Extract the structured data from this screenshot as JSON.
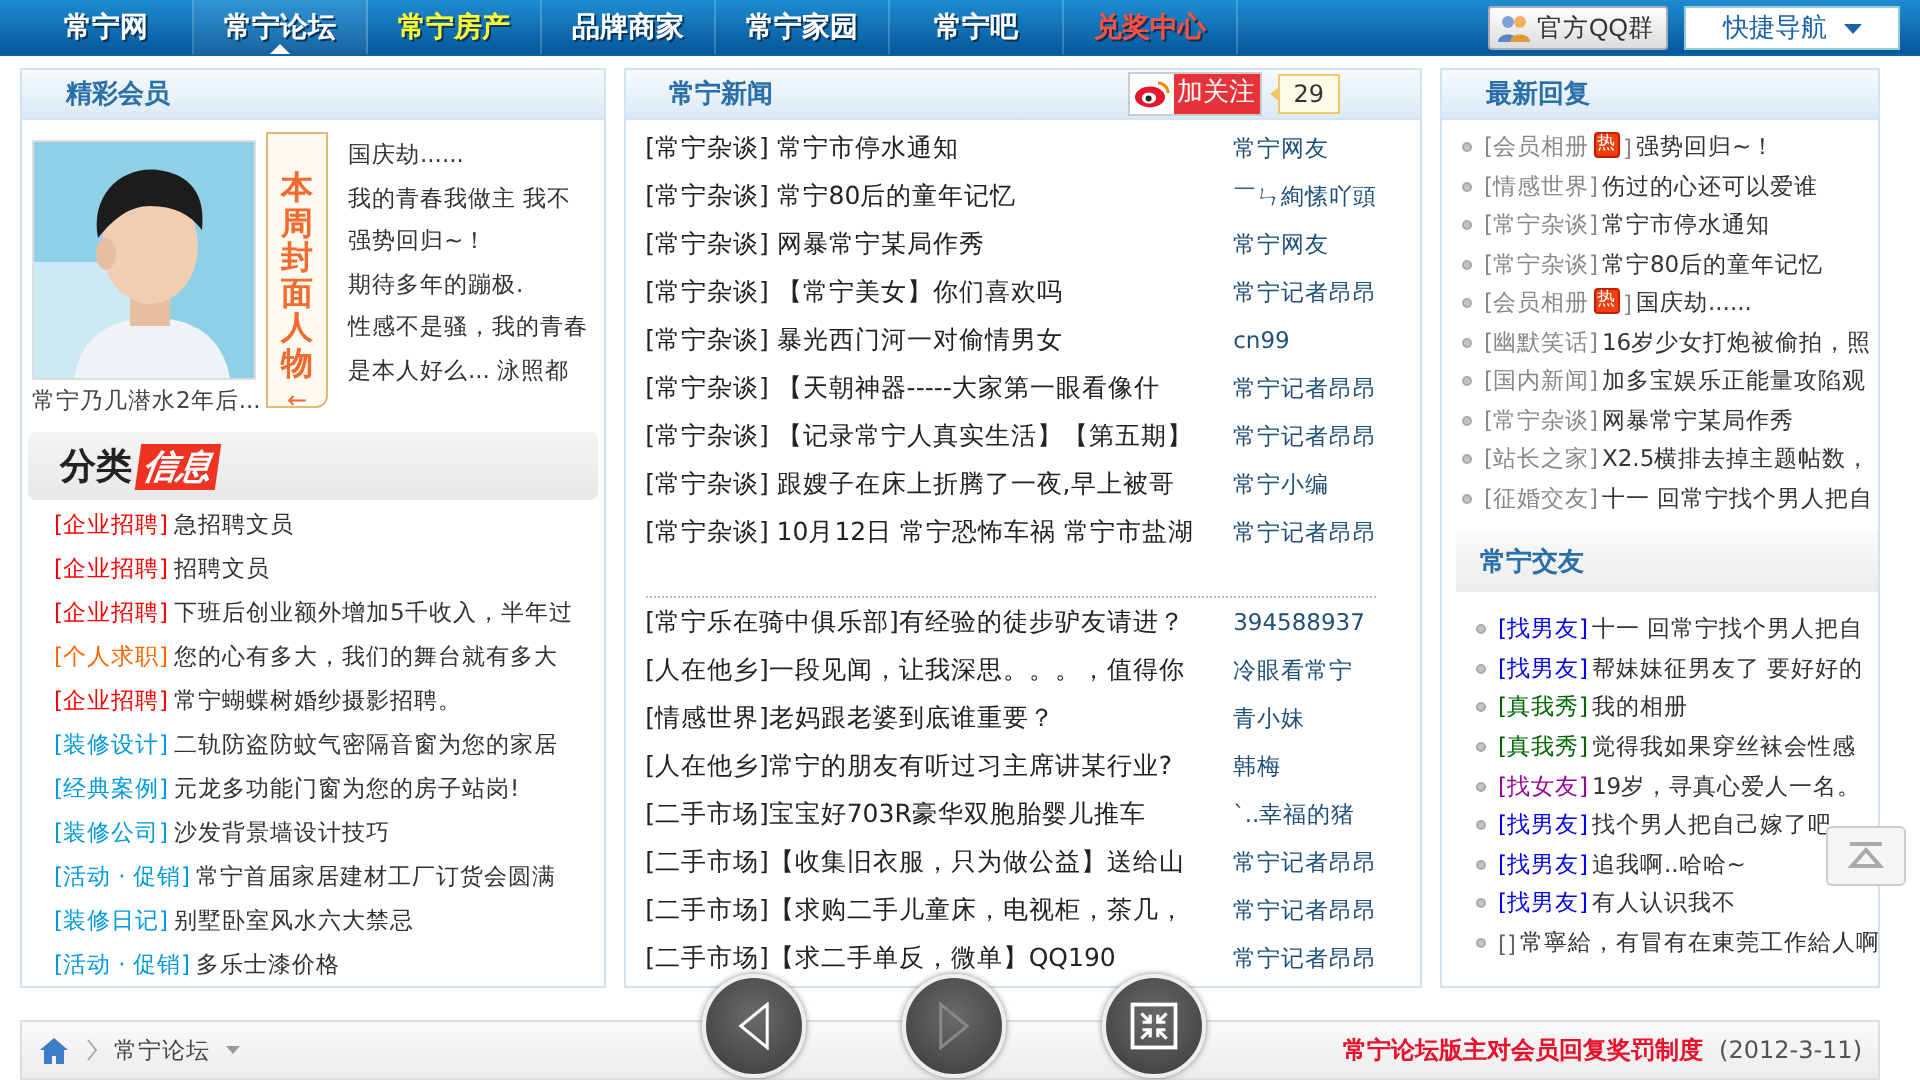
{
  "nav": {
    "items": [
      {
        "label": "常宁网",
        "selected": false,
        "color": "#ffffff"
      },
      {
        "label": "常宁论坛",
        "selected": true,
        "color": "#ffffff"
      },
      {
        "label": "常宁房产",
        "selected": false,
        "color": "#ffff33"
      },
      {
        "label": "品牌商家",
        "selected": false,
        "color": "#ffffff"
      },
      {
        "label": "常宁家园",
        "selected": false,
        "color": "#ffffff"
      },
      {
        "label": "常宁吧",
        "selected": false,
        "color": "#ffffff"
      },
      {
        "label": "兑奖中心",
        "selected": false,
        "color": "#ff5040"
      }
    ],
    "qq_button": "官方QQ群",
    "quick_nav": "快捷导航"
  },
  "members": {
    "title": "精彩会员",
    "photo": {
      "kind": "picture",
      "caption": "常宁乃几潜水2年后..."
    },
    "cover_tag": "本周封面人物",
    "cover_arrow": "←",
    "lines": [
      "国庆劫......",
      "我的青春我做主 我不",
      "强势回归~！",
      "期待多年的蹦极.",
      "性感不是骚，我的青春",
      "是本人好么... 泳照都"
    ]
  },
  "classifieds": {
    "title": "分类",
    "badge": "信息",
    "items": [
      {
        "category": "[企业招聘]",
        "color": "#ff0000",
        "text": "急招聘文员"
      },
      {
        "category": "[企业招聘]",
        "color": "#ff0000",
        "text": "招聘文员"
      },
      {
        "category": "[企业招聘]",
        "color": "#ff0000",
        "text": "下班后创业额外增加5千收入，半年过"
      },
      {
        "category": "[个人求职]",
        "color": "#ff6600",
        "text": "您的心有多大，我们的舞台就有多大"
      },
      {
        "category": "[企业招聘]",
        "color": "#ff0000",
        "text": "常宁蝴蝶树婚纱摄影招聘。"
      },
      {
        "category": "[装修设计]",
        "color": "#0099dd",
        "text": "二轨防盗防蚊气密隔音窗为您的家居"
      },
      {
        "category": "[经典案例]",
        "color": "#0099dd",
        "text": "元龙多功能门窗为您的房子站岗!"
      },
      {
        "category": "[装修公司]",
        "color": "#0099dd",
        "text": "沙发背景墙设计技巧"
      },
      {
        "category": "[活动 · 促销]",
        "color": "#0099dd",
        "text": "常宁首届家居建材工厂订货会圆满"
      },
      {
        "category": "[装修日记]",
        "color": "#0099dd",
        "text": "别墅卧室风水六大禁忌"
      },
      {
        "category": "[活动 · 促销]",
        "color": "#0099dd",
        "text": "多乐士漆价格"
      }
    ]
  },
  "news": {
    "title": "常宁新闻",
    "weibo": {
      "follow": "加关注",
      "count": "29"
    },
    "top_rows": [
      {
        "title": "[常宁杂谈] 常宁市停水通知",
        "author": "常宁网友"
      },
      {
        "title": "[常宁杂谈] 常宁80后的童年记忆",
        "author": "￣ㄣ絢愫吖頭"
      },
      {
        "title": "[常宁杂谈] 网暴常宁某局作秀",
        "author": "常宁网友"
      },
      {
        "title": "[常宁杂谈] 【常宁美女】你们喜欢吗",
        "author": "常宁记者昂昂"
      },
      {
        "title": "[常宁杂谈] 暴光西门河一对偷情男女",
        "author": "cn99"
      },
      {
        "title": "[常宁杂谈] 【天朝神器-----大家第一眼看像什",
        "author": "常宁记者昂昂"
      },
      {
        "title": "[常宁杂谈] 【记录常宁人真实生活】【第五期】",
        "author": "常宁记者昂昂"
      },
      {
        "title": "[常宁杂谈] 跟嫂子在床上折腾了一夜,早上被哥",
        "author": "常宁小编"
      },
      {
        "title": "[常宁杂谈] 10月12日 常宁恐怖车祸 常宁市盐湖",
        "author": "常宁记者昂昂"
      }
    ],
    "bottom_rows": [
      {
        "title": "[常宁乐在骑中俱乐部]有经验的徒步驴友请进？",
        "author": "394588937"
      },
      {
        "title": "[人在他乡]一段见闻，让我深思。。。，值得你",
        "author": "冷眼看常宁"
      },
      {
        "title": "[情感世界]老妈跟老婆到底谁重要？",
        "author": "青小妹"
      },
      {
        "title": "[人在他乡]常宁的朋友有听过习主席讲某行业?",
        "author": "韩梅"
      },
      {
        "title": "[二手市场]宝宝好703R豪华双胞胎婴儿推车",
        "author": "`..幸福的猪"
      },
      {
        "title": "[二手市场]【收集旧衣服，只为做公益】送给山",
        "author": "常宁记者昂昂"
      },
      {
        "title": "[二手市场]【求购二手儿童床，电视柜，茶几，",
        "author": "常宁记者昂昂"
      },
      {
        "title": "[二手市场]【求二手单反，微单】QQ190",
        "author": "常宁记者昂昂"
      }
    ]
  },
  "replies": {
    "title": "最新回复",
    "items": [
      {
        "category": "[会员相册",
        "badge": "热",
        "tail": "]",
        "title": "强势回归~！"
      },
      {
        "category": "[情感世界]",
        "title": "伤过的心还可以爱谁"
      },
      {
        "category": "[常宁杂谈]",
        "title": "常宁市停水通知"
      },
      {
        "category": "[常宁杂谈]",
        "title": "常宁80后的童年记忆"
      },
      {
        "category": "[会员相册",
        "badge": "热",
        "tail": "]",
        "title": "国庆劫......"
      },
      {
        "category": "[幽默笑话]",
        "title": "16岁少女打炮被偷拍，照"
      },
      {
        "category": "[国内新闻]",
        "title": "加多宝娱乐正能量攻陷观"
      },
      {
        "category": "[常宁杂谈]",
        "title": "网暴常宁某局作秀"
      },
      {
        "category": "[站长之家]",
        "title": "X2.5横排去掉主题帖数，"
      },
      {
        "category": "[征婚交友]",
        "title": "十一 回常宁找个男人把自"
      }
    ]
  },
  "friends": {
    "title": "常宁交友",
    "items": [
      {
        "category": "[找男友]",
        "color": "#0000ee",
        "title": "十一 回常宁找个男人把自"
      },
      {
        "category": "[找男友]",
        "color": "#0000ee",
        "title": "帮妹妹征男友了 要好好的"
      },
      {
        "category": "[真我秀]",
        "color": "#006600",
        "title": "我的相册"
      },
      {
        "category": "[真我秀]",
        "color": "#006600",
        "title": "觉得我如果穿丝袜会性感"
      },
      {
        "category": "[找女友]",
        "color": "#990099",
        "title": "19岁，寻真心爱人一名。"
      },
      {
        "category": "[找男友]",
        "color": "#0000ee",
        "title": "找个男人把自己嫁了吧"
      },
      {
        "category": "[找男友]",
        "color": "#0000ee",
        "title": "追我啊..哈哈~"
      },
      {
        "category": "[找男友]",
        "color": "#0000ee",
        "title": "有人认识我不"
      },
      {
        "category": "[]",
        "color": "#666666",
        "title": "常寧給，有冒有在東莞工作給人啊"
      }
    ]
  },
  "footer": {
    "crumb": "常宁论坛",
    "notice": "常宁论坛版主对会员回复奖罚制度",
    "date": "(2012-3-11)"
  },
  "overlay": {
    "buttons": [
      {
        "kind": "prev",
        "disabled": false
      },
      {
        "kind": "next",
        "disabled": true
      },
      {
        "kind": "collapse",
        "disabled": false
      }
    ]
  }
}
